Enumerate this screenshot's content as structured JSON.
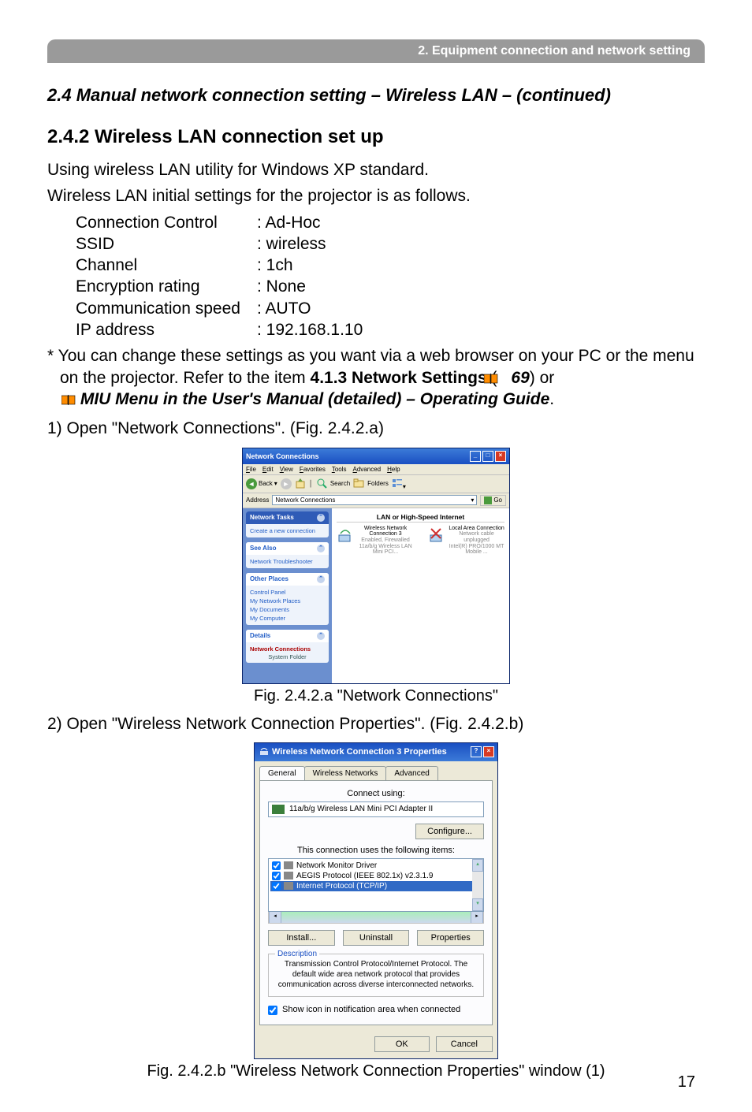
{
  "header_bar": "2. Equipment connection and network setting",
  "section_title": "2.4 Manual network connection setting – Wireless LAN – (continued)",
  "subsection_title": "2.4.2 Wireless LAN connection set up",
  "intro_line1": "Using wireless LAN utility for Windows XP standard.",
  "intro_line2": "Wireless LAN initial settings for the projector is as follows.",
  "settings": [
    {
      "label": "Connection Control",
      "value": ": Ad-Hoc"
    },
    {
      "label": "SSID",
      "value": ": wireless"
    },
    {
      "label": "Channel",
      "value": ": 1ch"
    },
    {
      "label": "Encryption rating",
      "value": ": None"
    },
    {
      "label": "Communication speed",
      "value": ": AUTO"
    },
    {
      "label": "IP address",
      "value": ": 192.168.1.10"
    }
  ],
  "note_prefix": "* You can change these settings as you want via a web browser on your PC or the menu on the projector. Refer to the item ",
  "note_bold": "4.1.3 Network Settings",
  "note_open_paren": " (",
  "note_ref": "69",
  "note_close_paren": ") or ",
  "note_manual": "MIU Menu in the User's Manual (detailed) – Operating Guide",
  "note_period": ".",
  "step1": "1) Open \"Network Connections\". (Fig. 2.4.2.a)",
  "fig_a_caption": "Fig. 2.4.2.a \"Network Connections\"",
  "step2": "2) Open \"Wireless Network Connection Properties\". (Fig. 2.4.2.b)",
  "fig_b_caption": "Fig. 2.4.2.b \"Wireless Network Connection Properties\" window (1)",
  "page_number": "17",
  "win_connections": {
    "title": "Network Connections",
    "menu": [
      "File",
      "Edit",
      "View",
      "Favorites",
      "Tools",
      "Advanced",
      "Help"
    ],
    "toolbar": {
      "back": "Back",
      "search": "Search",
      "folders": "Folders"
    },
    "address_label": "Address",
    "address_value": "Network Connections",
    "go": "Go",
    "side": {
      "network_tasks": {
        "title": "Network Tasks",
        "items": [
          "Create a new connection"
        ]
      },
      "see_also": {
        "title": "See Also",
        "items": [
          "Network Troubleshooter"
        ]
      },
      "other_places": {
        "title": "Other Places",
        "items": [
          "Control Panel",
          "My Network Places",
          "My Documents",
          "My Computer"
        ]
      },
      "details": {
        "title": "Details",
        "name": "Network Connections",
        "type": "System Folder"
      }
    },
    "category": "LAN or High-Speed Internet",
    "items": [
      {
        "title": "Wireless Network Connection 3",
        "line2": "Enabled, Firewalled",
        "line3": "11a/b/g Wireless LAN Mini PCI..."
      },
      {
        "title": "Local Area Connection",
        "line2": "Network cable unplugged",
        "line3": "Intel(R) PRO/1000 MT Mobile ..."
      }
    ]
  },
  "win_props": {
    "title": "Wireless Network Connection 3 Properties",
    "tabs": [
      "General",
      "Wireless Networks",
      "Advanced"
    ],
    "connect_using": "Connect using:",
    "adapter": "11a/b/g Wireless LAN Mini PCI Adapter II",
    "configure": "Configure...",
    "items_label": "This connection uses the following items:",
    "items": [
      "Network Monitor Driver",
      "AEGIS Protocol (IEEE 802.1x) v2.3.1.9",
      "Internet Protocol (TCP/IP)"
    ],
    "install": "Install...",
    "uninstall": "Uninstall",
    "properties": "Properties",
    "desc_title": "Description",
    "desc_body": "Transmission Control Protocol/Internet Protocol. The default wide area network protocol that provides communication across diverse interconnected networks.",
    "show_icon": "Show icon in notification area when connected",
    "ok": "OK",
    "cancel": "Cancel"
  }
}
